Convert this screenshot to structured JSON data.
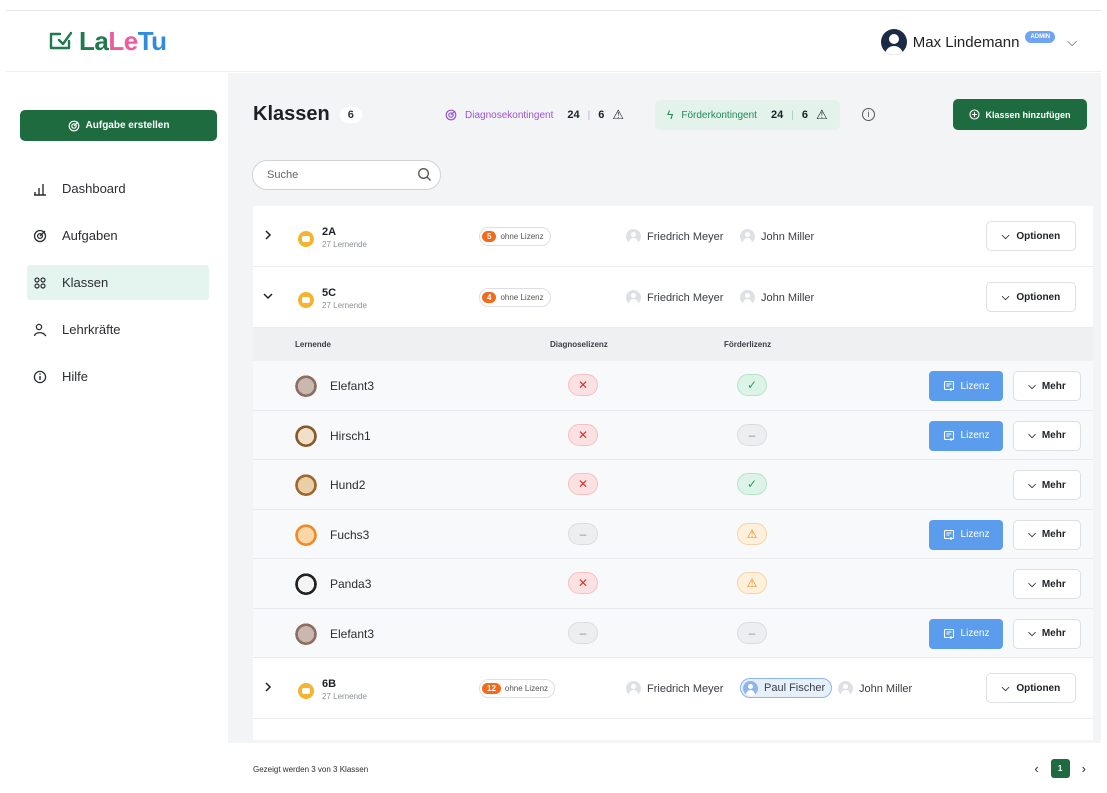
{
  "app": {
    "logo": {
      "part1": "La",
      "part2": "Le",
      "part3": "Tu"
    },
    "user": {
      "name": "Max Lindemann",
      "badge": "ADMIN"
    }
  },
  "sidebar": {
    "create_button": "Aufgabe erstellen",
    "items": [
      {
        "label": "Dashboard",
        "icon": "chart-bars-icon",
        "active": false
      },
      {
        "label": "Aufgaben",
        "icon": "target-icon",
        "active": false
      },
      {
        "label": "Klassen",
        "icon": "grid-people-icon",
        "active": true
      },
      {
        "label": "Lehrkräfte",
        "icon": "person-icon",
        "active": false
      },
      {
        "label": "Hilfe",
        "icon": "info-icon",
        "active": false
      }
    ]
  },
  "main": {
    "title": "Klassen",
    "count": "6",
    "diag": {
      "label": "Diagnosekontingent",
      "used": "24",
      "left": "6"
    },
    "foerd": {
      "label": "Förderkontingent",
      "used": "24",
      "left": "6"
    },
    "add_button": "Klassen hinzufügen",
    "search_placeholder": "Suche",
    "options_label": "Optionen",
    "no_license_label": "ohne Lizenz",
    "classes": [
      {
        "name": "2A",
        "sub": "27 Lernende",
        "no_license": "5",
        "teachers": [
          "Friedrich Meyer",
          "John Miller"
        ]
      },
      {
        "name": "5C",
        "sub": "27 Lernende",
        "no_license": "4",
        "teachers": [
          "Friedrich Meyer",
          "John Miller"
        ]
      },
      {
        "name": "6B",
        "sub": "27 Lernende",
        "no_license": "12",
        "teachers": [
          "Friedrich Meyer",
          "Paul Fischer",
          "John Miller"
        ]
      }
    ],
    "student_table": {
      "headers": [
        "Lernende",
        "Diagnoselizenz",
        "Förderlizenz"
      ],
      "lizenz_label": "Lizenz",
      "mehr_label": "Mehr",
      "rows": [
        {
          "name": "Elefant3",
          "avatar": "elephant-avatar",
          "diag": "x",
          "foerd": "check",
          "lizenz": true
        },
        {
          "name": "Hirsch1",
          "avatar": "deer-avatar",
          "diag": "x",
          "foerd": "dash",
          "lizenz": true
        },
        {
          "name": "Hund2",
          "avatar": "dog-avatar",
          "diag": "x",
          "foerd": "check",
          "lizenz": false
        },
        {
          "name": "Fuchs3",
          "avatar": "fox-avatar",
          "diag": "dash",
          "foerd": "warn",
          "lizenz": true
        },
        {
          "name": "Panda3",
          "avatar": "panda-avatar",
          "diag": "x",
          "foerd": "warn",
          "lizenz": false
        },
        {
          "name": "Elefant3",
          "avatar": "elephant-avatar",
          "diag": "dash",
          "foerd": "dash",
          "lizenz": true
        }
      ]
    },
    "footer": {
      "text": "Gezeigt werden 3 von 3 Klassen",
      "page": "1"
    }
  }
}
